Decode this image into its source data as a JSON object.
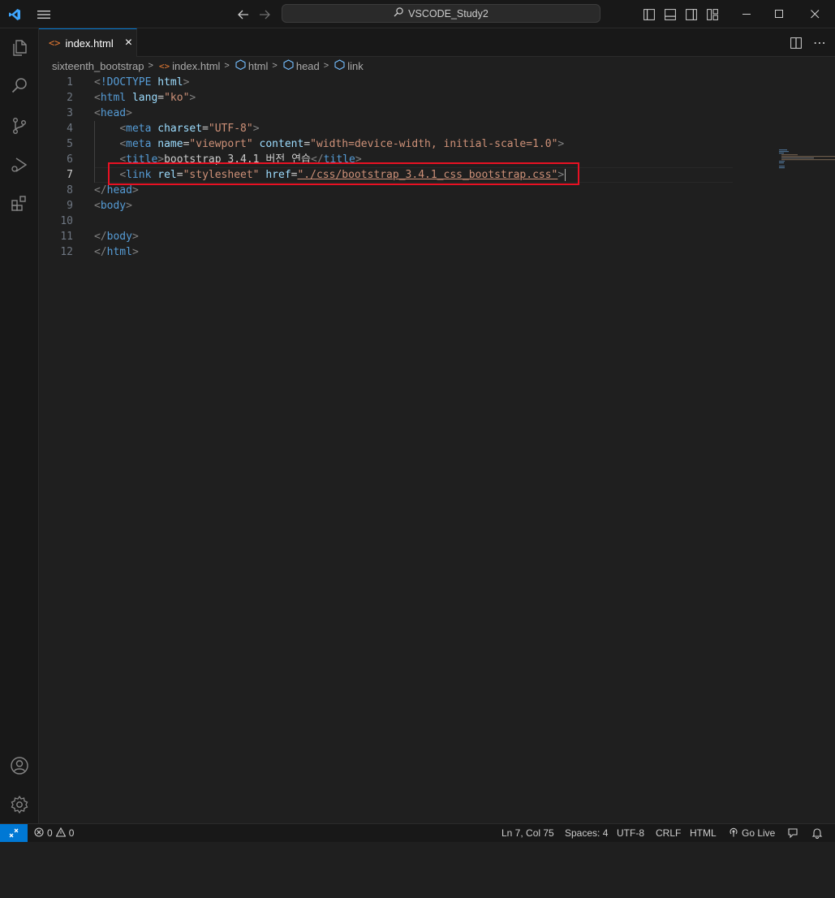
{
  "titlebar": {
    "search_label": "VSCODE_Study2",
    "icons": [
      "vscode-logo-icon",
      "menu-icon",
      "back-arrow-icon",
      "forward-arrow-icon",
      "search-icon",
      "toggle-primary-sidebar-icon",
      "toggle-panel-icon",
      "toggle-secondary-sidebar-icon",
      "customize-layout-icon",
      "minimize-icon",
      "maximize-icon",
      "close-icon"
    ]
  },
  "activity_bar": {
    "items": [
      "explorer-icon",
      "search-icon",
      "source-control-icon",
      "run-debug-icon",
      "extensions-icon"
    ],
    "bottom": [
      "account-icon",
      "settings-gear-icon"
    ]
  },
  "tabs": [
    {
      "label": "index.html",
      "close": "×"
    }
  ],
  "breadcrumb": [
    "sixteenth_bootstrap",
    "index.html",
    "html",
    "head",
    "link"
  ],
  "editor": {
    "lines": [
      {
        "n": "1",
        "tokens": [
          [
            "t-punc",
            "<"
          ],
          [
            "t-doc",
            "!DOCTYPE"
          ],
          [
            "t-txt",
            " "
          ],
          [
            "t-kw",
            "html"
          ],
          [
            "t-punc",
            ">"
          ]
        ]
      },
      {
        "n": "2",
        "tokens": [
          [
            "t-punc",
            "<"
          ],
          [
            "t-tag",
            "html"
          ],
          [
            "t-txt",
            " "
          ],
          [
            "t-attr",
            "lang"
          ],
          [
            "t-txt",
            "="
          ],
          [
            "t-str",
            "\"ko\""
          ],
          [
            "t-punc",
            ">"
          ]
        ]
      },
      {
        "n": "3",
        "tokens": [
          [
            "t-punc",
            "<"
          ],
          [
            "t-tag",
            "head"
          ],
          [
            "t-punc",
            ">"
          ]
        ]
      },
      {
        "n": "4",
        "tokens": [
          [
            "t-txt",
            "    "
          ],
          [
            "t-punc",
            "<"
          ],
          [
            "t-tag",
            "meta"
          ],
          [
            "t-txt",
            " "
          ],
          [
            "t-attr",
            "charset"
          ],
          [
            "t-txt",
            "="
          ],
          [
            "t-str",
            "\"UTF-8\""
          ],
          [
            "t-punc",
            ">"
          ]
        ]
      },
      {
        "n": "5",
        "tokens": [
          [
            "t-txt",
            "    "
          ],
          [
            "t-punc",
            "<"
          ],
          [
            "t-tag",
            "meta"
          ],
          [
            "t-txt",
            " "
          ],
          [
            "t-attr",
            "name"
          ],
          [
            "t-txt",
            "="
          ],
          [
            "t-str",
            "\"viewport\""
          ],
          [
            "t-txt",
            " "
          ],
          [
            "t-attr",
            "content"
          ],
          [
            "t-txt",
            "="
          ],
          [
            "t-str",
            "\"width=device-width, initial-scale=1.0\""
          ],
          [
            "t-punc",
            ">"
          ]
        ]
      },
      {
        "n": "6",
        "tokens": [
          [
            "t-txt",
            "    "
          ],
          [
            "t-punc",
            "<"
          ],
          [
            "t-tag",
            "title"
          ],
          [
            "t-punc",
            ">"
          ],
          [
            "t-txt",
            "bootstrap 3.4.1 버전 연습"
          ],
          [
            "t-punc",
            "</"
          ],
          [
            "t-tag",
            "title"
          ],
          [
            "t-punc",
            ">"
          ]
        ]
      },
      {
        "n": "7",
        "tokens": [
          [
            "t-txt",
            "    "
          ],
          [
            "t-punc",
            "<"
          ],
          [
            "t-tag",
            "link"
          ],
          [
            "t-txt",
            " "
          ],
          [
            "t-attr",
            "rel"
          ],
          [
            "t-txt",
            "="
          ],
          [
            "t-str",
            "\"stylesheet\""
          ],
          [
            "t-txt",
            " "
          ],
          [
            "t-attr",
            "href"
          ],
          [
            "t-txt",
            "="
          ],
          [
            "t-str",
            "\"./css/bootstrap_3.4.1_css_bootstrap.css\""
          ],
          [
            "t-punc",
            ">"
          ]
        ]
      },
      {
        "n": "8",
        "tokens": [
          [
            "t-punc",
            "</"
          ],
          [
            "t-tag",
            "head"
          ],
          [
            "t-punc",
            ">"
          ]
        ]
      },
      {
        "n": "9",
        "tokens": [
          [
            "t-punc",
            "<"
          ],
          [
            "t-tag",
            "body"
          ],
          [
            "t-punc",
            ">"
          ]
        ]
      },
      {
        "n": "10",
        "tokens": []
      },
      {
        "n": "11",
        "tokens": [
          [
            "t-punc",
            "</"
          ],
          [
            "t-tag",
            "body"
          ],
          [
            "t-punc",
            ">"
          ]
        ]
      },
      {
        "n": "12",
        "tokens": [
          [
            "t-punc",
            "</"
          ],
          [
            "t-tag",
            "html"
          ],
          [
            "t-punc",
            ">"
          ]
        ]
      }
    ],
    "active_line": "7"
  },
  "statusbar": {
    "errors": "0",
    "warnings": "0",
    "position": "Ln 7, Col 75",
    "spaces": "Spaces: 4",
    "encoding": "UTF-8",
    "eol": "CRLF",
    "language": "HTML",
    "go_live": "Go Live"
  },
  "colors": {
    "accent": "#0078d4",
    "highlight_box": "#e81123",
    "background": "#1f1f1f"
  }
}
